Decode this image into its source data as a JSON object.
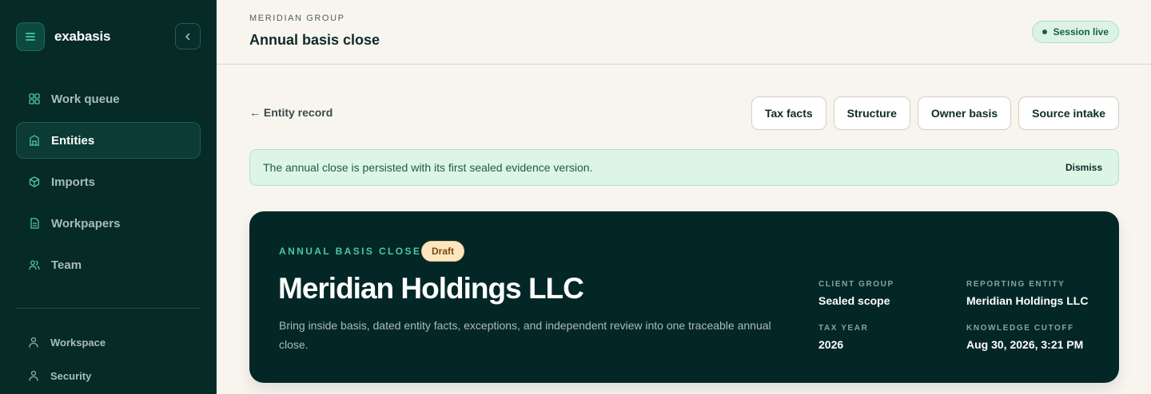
{
  "app": {
    "name": "exabasis"
  },
  "sidebar": {
    "nav": [
      {
        "label": "Work queue",
        "icon": "grid-icon"
      },
      {
        "label": "Entities",
        "icon": "building-icon",
        "active": true
      },
      {
        "label": "Imports",
        "icon": "box-icon"
      },
      {
        "label": "Workpapers",
        "icon": "document-icon"
      },
      {
        "label": "Team",
        "icon": "users-icon"
      }
    ],
    "secondary": [
      {
        "label": "Workspace",
        "icon": "person-icon"
      },
      {
        "label": "Security",
        "icon": "person-icon"
      }
    ]
  },
  "header": {
    "eyebrow": "MERIDIAN GROUP",
    "title": "Annual basis close",
    "status": "Session live"
  },
  "toolbar": {
    "back_label": "← Entity record",
    "tabs": [
      "Tax facts",
      "Structure",
      "Owner basis",
      "Source intake"
    ]
  },
  "alert": {
    "message": "The annual close is persisted with its first sealed evidence version.",
    "dismiss_label": "Dismiss"
  },
  "hero": {
    "eyebrow": "ANNUAL BASIS CLOSE",
    "badge": "Draft",
    "title": "Meridian Holdings LLC",
    "description": "Bring inside basis, dated entity facts, exceptions, and independent review into one traceable annual close.",
    "meta": [
      {
        "label": "CLIENT GROUP",
        "value": "Sealed scope"
      },
      {
        "label": "REPORTING ENTITY",
        "value": "Meridian Holdings LLC"
      },
      {
        "label": "TAX YEAR",
        "value": "2026"
      },
      {
        "label": "KNOWLEDGE CUTOFF",
        "value": "Aug 30, 2026, 3:21 PM"
      }
    ]
  },
  "colors": {
    "sidebar_bg": "#062a26",
    "accent": "#4cc8a0",
    "page_bg": "#f8f5ef",
    "hero_bg": "#032726",
    "success_bg": "#dcf5e4",
    "draft_bg": "#fbe6bf"
  }
}
